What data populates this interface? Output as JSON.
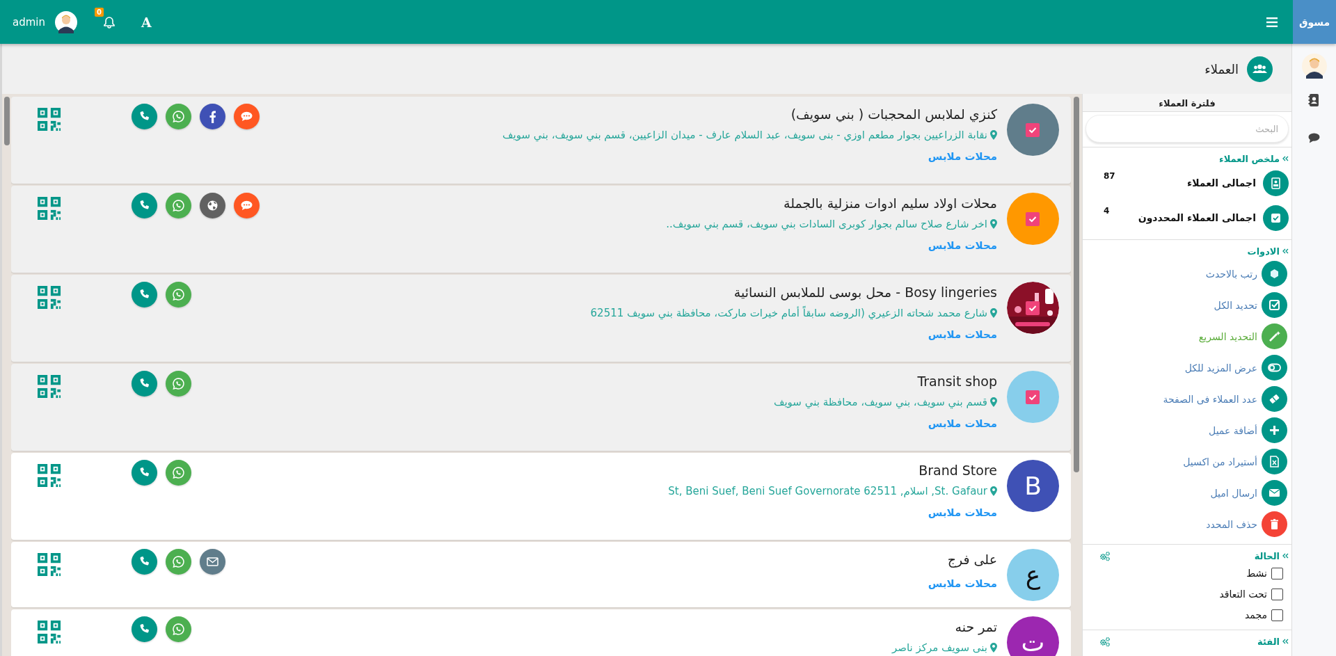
{
  "topbar": {
    "brand": "مسوق",
    "user": "admin",
    "notifications": "0",
    "font_button": "A"
  },
  "page": {
    "title": "العملاء"
  },
  "customers": [
    {
      "name": "كنزي لملابس المحجبات ( بني سويف)",
      "address": "نقابة الزراعيين بجوار مطعم اوزي - بنى سويف، عبد السلام عارف - ميدان الزاعيين، قسم بني سويف، بني سويف",
      "category": "محلات ملابس",
      "selected": true,
      "avatar": {
        "kind": "plain",
        "color": "#607d8b"
      },
      "actions": [
        {
          "kind": "phone"
        },
        {
          "kind": "whatsapp"
        },
        {
          "kind": "facebook"
        },
        {
          "kind": "chat"
        }
      ]
    },
    {
      "name": "محلات اولاد سليم ادوات منزلية بالجملة",
      "address": "اخر شارع صلاح سالم بجوار كوبرى السادات بني سويف، قسم بني سويف..",
      "category": "محلات ملابس",
      "selected": true,
      "avatar": {
        "kind": "plain",
        "color": "#ff9800"
      },
      "actions": [
        {
          "kind": "phone"
        },
        {
          "kind": "whatsapp"
        },
        {
          "kind": "web"
        },
        {
          "kind": "chat"
        }
      ]
    },
    {
      "name": "Bosy lingeries - محل بوسى للملابس النسائية",
      "address": "شارع محمد شحاته الزعيري (الروضه سابقاً أمام خيرات ماركت، محافظة بني سويف 62511",
      "category": "محلات ملابس",
      "selected": true,
      "avatar": {
        "kind": "picture"
      },
      "actions": [
        {
          "kind": "phone"
        },
        {
          "kind": "whatsapp"
        }
      ]
    },
    {
      "name": "Transit shop",
      "address": "قسم بني سويف، بني سويف، محافظة بني سويف",
      "category": "محلات ملابس",
      "selected": true,
      "avatar": {
        "kind": "plain",
        "color": "#87ceeb"
      },
      "actions": [
        {
          "kind": "phone"
        },
        {
          "kind": "whatsapp"
        }
      ]
    },
    {
      "name": "Brand Store",
      "address": "St. Gafaur, اسلام, St, Beni Suef, Beni Suef Governorate 62511",
      "category": "محلات ملابس",
      "selected": false,
      "avatar": {
        "kind": "letter",
        "letter": "B",
        "color": "#3f51b5"
      },
      "actions": [
        {
          "kind": "phone"
        },
        {
          "kind": "whatsapp"
        }
      ]
    },
    {
      "name": "على فرج",
      "category": "محلات ملابس",
      "selected": false,
      "avatar": {
        "kind": "letter",
        "letter": "ع",
        "color": "#87ceeb"
      },
      "actions": [
        {
          "kind": "phone"
        },
        {
          "kind": "whatsapp"
        },
        {
          "kind": "email"
        }
      ]
    },
    {
      "name": "تمر حنه",
      "address": "بنى سويف مركز ناصر",
      "selected": false,
      "avatar": {
        "kind": "letter",
        "letter": "ت",
        "color": "#9c27b0"
      },
      "actions": [
        {
          "kind": "phone"
        },
        {
          "kind": "whatsapp"
        }
      ]
    }
  ],
  "filter": {
    "title": "فلترة العملاء",
    "search": {
      "placeholder": "البحث"
    },
    "summary": {
      "title": "ملخص العملاء",
      "stats": [
        {
          "kind": "total",
          "label": "اجمالى العملاء",
          "value": "87"
        },
        {
          "kind": "selected",
          "label": "اجمالى العملاء المحددون",
          "value": "4"
        }
      ]
    },
    "tools": {
      "title": "الادوات",
      "items": [
        {
          "kind": "sort",
          "label": "رتب بالاحدث",
          "color": "#009688",
          "highlighted": false
        },
        {
          "kind": "select_all",
          "label": "تحديد الكل",
          "color": "#009688",
          "highlighted": false
        },
        {
          "kind": "quick",
          "label": "التحديد السريع",
          "color": "#4caf50",
          "highlighted": true
        },
        {
          "kind": "expand",
          "label": "عرض المزيد للكل",
          "color": "#009688",
          "highlighted": false
        },
        {
          "kind": "page_size",
          "label": "عدد العملاء فى الصفحة",
          "color": "#009688",
          "highlighted": false
        },
        {
          "kind": "add",
          "label": "أضافة عميل",
          "color": "#009688",
          "highlighted": false
        },
        {
          "kind": "import",
          "label": "أستيراد من اكسيل",
          "color": "#009688",
          "highlighted": false
        },
        {
          "kind": "email",
          "label": "ارسال اميل",
          "color": "#009688",
          "highlighted": false
        },
        {
          "kind": "delete",
          "label": "حذف المحدد",
          "color": "#f44336",
          "highlighted": false
        }
      ]
    },
    "status": {
      "title": "الحالة",
      "options": [
        {
          "label": "نشط",
          "checked": false
        },
        {
          "label": "تحت التعاقد",
          "checked": false
        },
        {
          "label": "مجمد",
          "checked": false
        }
      ]
    },
    "category": {
      "title": "الفئة"
    }
  }
}
